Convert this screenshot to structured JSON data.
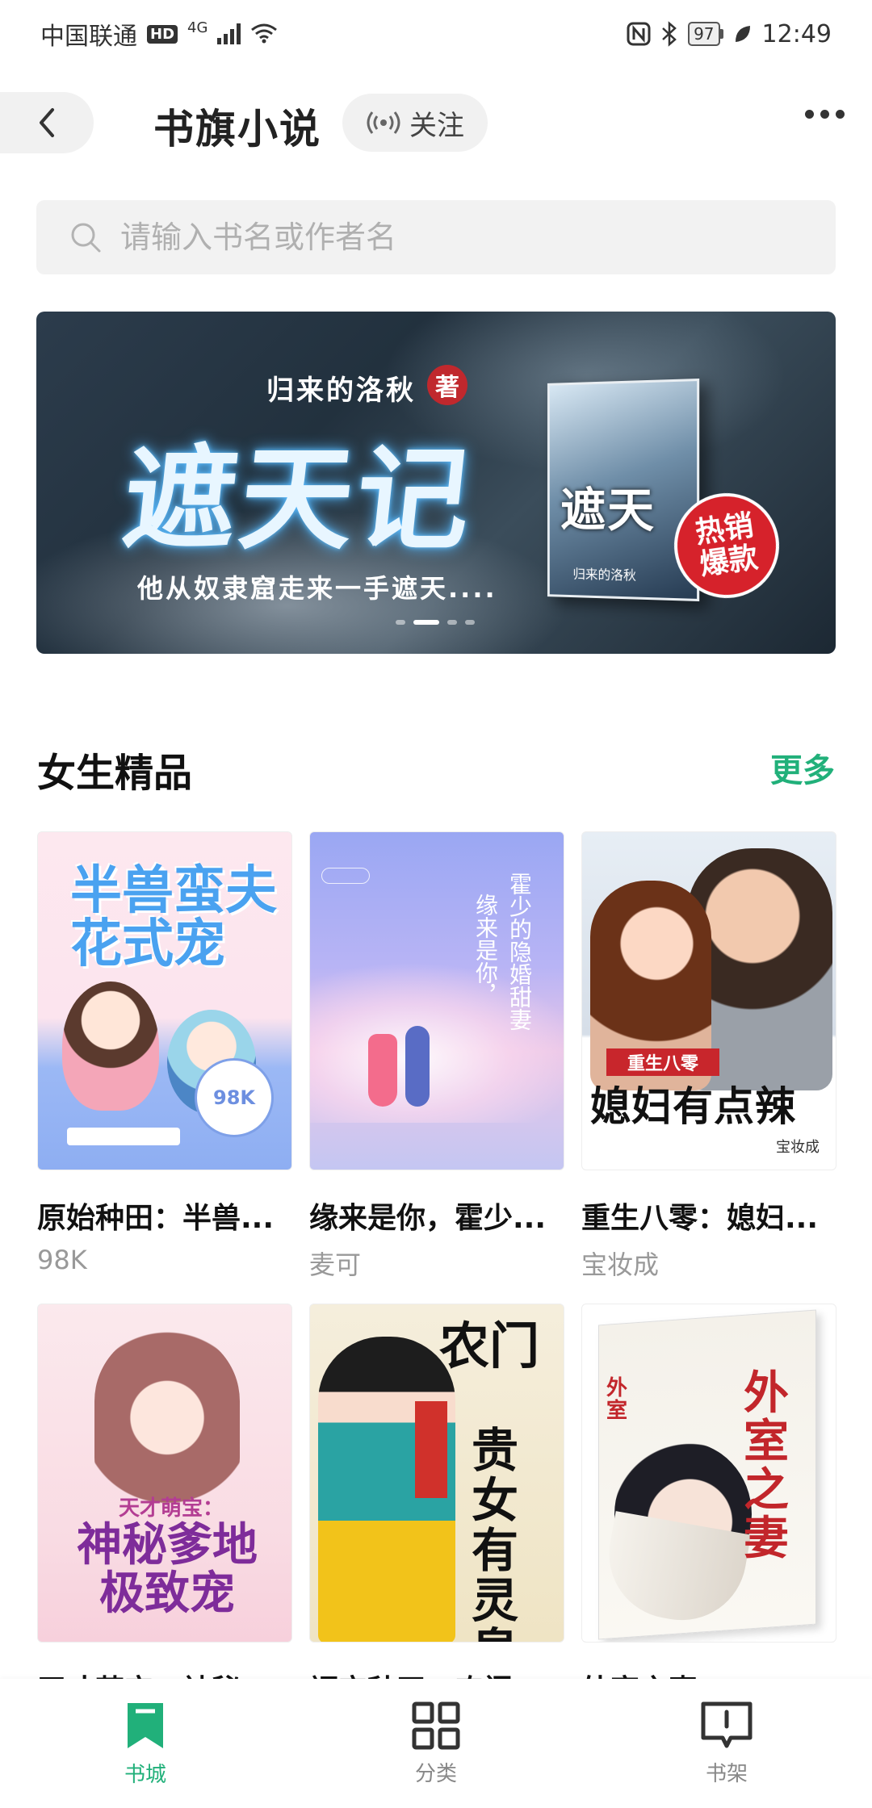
{
  "status_bar": {
    "carrier": "中国联通",
    "hd": "HD",
    "network": "4G",
    "battery": "97",
    "time": "12:49"
  },
  "header": {
    "title": "书旗小说",
    "follow_label": "关注"
  },
  "search": {
    "placeholder": "请输入书名或作者名"
  },
  "banner": {
    "author": "归来的洛秋",
    "author_badge": "著",
    "title": "遮天记",
    "tagline": "他从奴隶窟走来一手遮天....",
    "book_cover_title": "遮天",
    "badge_line1": "热销",
    "badge_line2": "爆款",
    "slide_count": 4,
    "active_slide": 1
  },
  "section": {
    "title": "女生精品",
    "more_label": "更多"
  },
  "books": [
    {
      "title": "原始种田：半兽...",
      "author": "98K",
      "cover_text": "半兽蛮夫花式宠",
      "cover_badge": "98K"
    },
    {
      "title": "缘来是你，霍少...",
      "author": "麦可",
      "cover_text_1": "霍少的隐婚甜妻",
      "cover_text_2": "缘来是你，"
    },
    {
      "title": "重生八零：媳妇...",
      "author": "宝妆成",
      "cover_tag": "重生八零",
      "cover_text": "媳妇有点辣",
      "cover_author": "宝妆成"
    },
    {
      "title": "天才萌宝：神秘...",
      "author": "",
      "cover_sub": "天才萌宝：",
      "cover_text": "神秘爹地极致宠"
    },
    {
      "title": "福宝种田：农门...",
      "author": "",
      "cover_text_1": "农门",
      "cover_text_2": "贵女有灵泉"
    },
    {
      "title": "外室之妻",
      "author": "",
      "cover_text": "外室之妻",
      "cover_side": "外室"
    }
  ],
  "nav": [
    {
      "label": "书城",
      "icon": "bookmark-icon",
      "active": true
    },
    {
      "label": "分类",
      "icon": "grid-icon",
      "active": false
    },
    {
      "label": "书架",
      "icon": "bookshelf-icon",
      "active": false
    }
  ],
  "colors": {
    "accent": "#21b07a",
    "hot_badge": "#d6222b"
  }
}
